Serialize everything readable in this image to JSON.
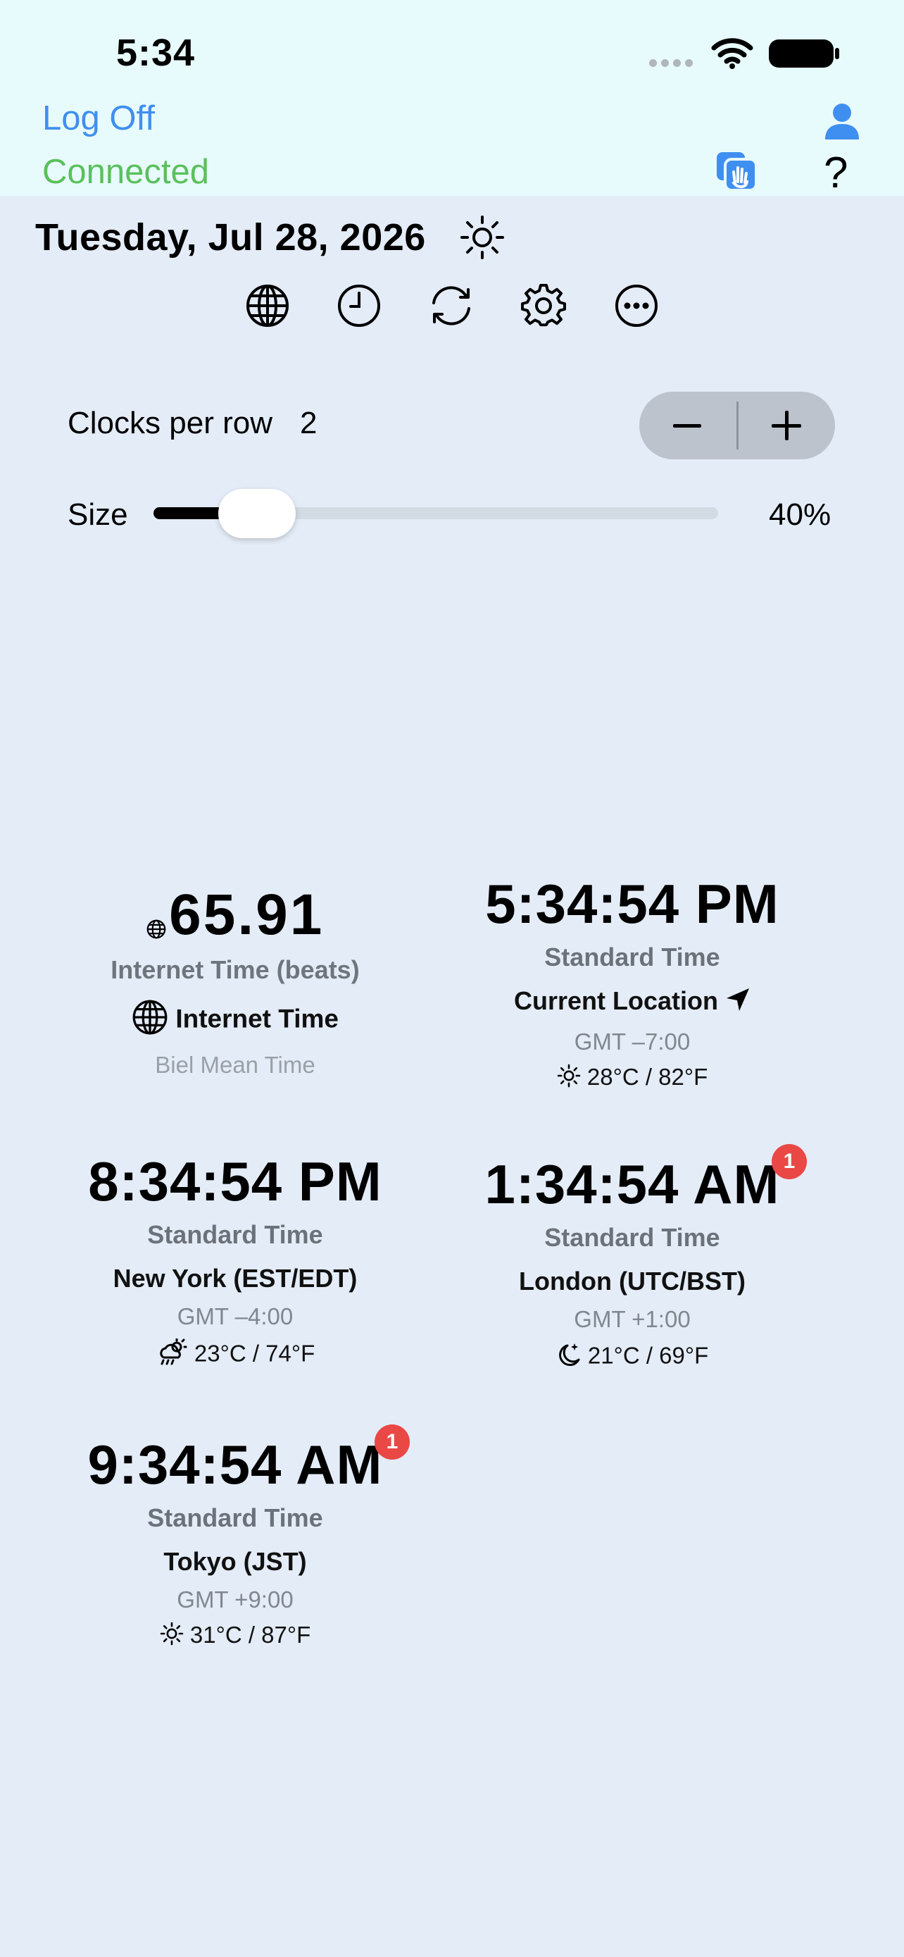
{
  "status_bar": {
    "time": "5:34"
  },
  "header": {
    "log_off": "Log Off",
    "connection_status": "Connected",
    "help": "?"
  },
  "date_bar": {
    "date": "Tuesday, Jul 28, 2026"
  },
  "toolbar": {
    "icons": [
      "globe-icon",
      "clock-icon",
      "sync-icon",
      "gear-icon",
      "more-icon"
    ]
  },
  "settings": {
    "clocks_per_row_label": "Clocks per row",
    "clocks_per_row_value": "2",
    "size_label": "Size",
    "size_value": "40%",
    "size_fraction": 0.4
  },
  "clocks": [
    {
      "time": "65.91",
      "subtitle": "Internet Time (beats)",
      "name": "Internet Time",
      "zone": "Biel Mean Time"
    },
    {
      "time": "5:34:54 PM",
      "subtitle": "Standard Time",
      "name": "Current Location",
      "gmt": "GMT –7:00",
      "weather": "28°C / 82°F",
      "weather_icon": "sun-icon"
    },
    {
      "time": "8:34:54 PM",
      "subtitle": "Standard Time",
      "name": "New York (EST/EDT)",
      "gmt": "GMT –4:00",
      "weather": "23°C / 74°F",
      "weather_icon": "cloud-sun-rain-icon"
    },
    {
      "time": "1:34:54 AM",
      "subtitle": "Standard Time",
      "name": "London (UTC/BST)",
      "gmt": "GMT +1:00",
      "weather": "21°C / 69°F",
      "weather_icon": "moon-stars-icon",
      "badge": "1"
    },
    {
      "time": "9:34:54 AM",
      "subtitle": "Standard Time",
      "name": "Tokyo (JST)",
      "gmt": "GMT +9:00",
      "weather": "31°C / 87°F",
      "weather_icon": "sun-icon",
      "badge": "1"
    }
  ],
  "colors": {
    "header_background": "#e8fbfc",
    "page_background": "#e4ecf7",
    "accent_blue": "#3f8ff0",
    "connected_green": "#5ac05c",
    "badge_red": "#e94845"
  }
}
